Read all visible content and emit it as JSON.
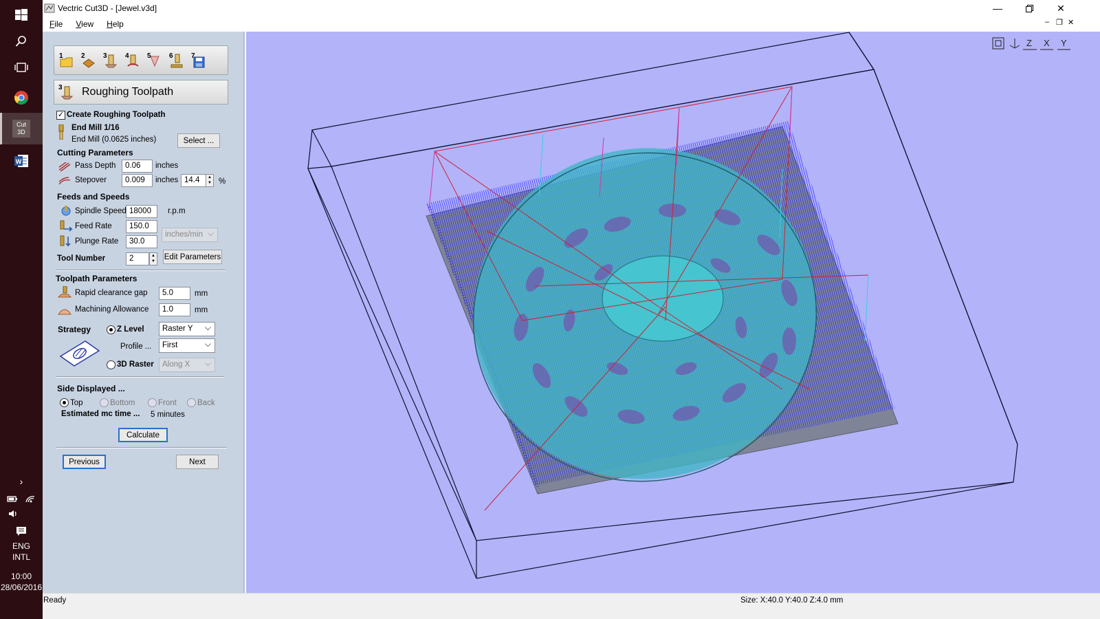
{
  "window": {
    "title": "Vectric Cut3D - [Jewel.v3d]"
  },
  "menu": [
    {
      "key": "F",
      "rest": "ile"
    },
    {
      "key": "V",
      "rest": "iew"
    },
    {
      "key": "H",
      "rest": "elp"
    }
  ],
  "taskbar": {
    "app_label_line1": "Cut",
    "app_label_line2": "3D",
    "language": "ENG",
    "layout": "INTL",
    "time": "10:00",
    "date": "28/06/2016"
  },
  "wizard_steps": [
    "1",
    "2",
    "3",
    "4",
    "5",
    "6",
    "7"
  ],
  "panel": {
    "step_number": "3",
    "heading": "Roughing Toolpath",
    "create_checkbox": {
      "label": "Create Roughing Toolpath",
      "checked": true
    },
    "tool": {
      "name": "End Mill 1/16",
      "description": "End Mill (0.0625 inches)",
      "select_label": "Select ..."
    },
    "cutting": {
      "title": "Cutting Parameters",
      "pass_depth_label": "Pass Depth",
      "pass_depth": "0.06",
      "pass_depth_unit": "inches",
      "stepover_label": "Stepover",
      "stepover": "0.009",
      "stepover_unit": "inches",
      "stepover_pct": "14.4",
      "pct": "%"
    },
    "feeds": {
      "title": "Feeds and Speeds",
      "spindle_label": "Spindle Speed",
      "spindle": "18000",
      "spindle_unit": "r.p.m",
      "feed_label": "Feed Rate",
      "feed": "150.0",
      "plunge_label": "Plunge Rate",
      "plunge": "30.0",
      "rate_unit": "inches/min",
      "tool_number_label": "Tool Number",
      "tool_number": "2",
      "edit_label": "Edit Parameters"
    },
    "toolpath": {
      "title": "Toolpath Parameters",
      "rapid_label": "Rapid clearance gap",
      "rapid": "5.0",
      "rapid_unit": "mm",
      "allowance_label": "Machining Allowance",
      "allowance": "1.0",
      "allowance_unit": "mm"
    },
    "strategy": {
      "title": "Strategy",
      "zlevel_label": "Z Level",
      "zlevel_selected": true,
      "zlevel_option": "Raster Y",
      "profile_label": "Profile ...",
      "profile_option": "First",
      "raster_label": "3D Raster",
      "raster_option": "Along X"
    },
    "side": {
      "title": "Side Displayed ...",
      "options": [
        "Top",
        "Bottom",
        "Front",
        "Back"
      ],
      "selected": "Top",
      "estimate_label": "Estimated mc time ...",
      "estimate_value": "5 minutes"
    },
    "calculate_label": "Calculate",
    "previous_label": "Previous",
    "next_label": "Next"
  },
  "view_toolbar": [
    "zoom-extents-icon",
    "iso-view-icon",
    "view-z-icon",
    "view-x-icon",
    "view-y-icon"
  ],
  "view_axis_labels": [
    "Z",
    "X",
    "Y"
  ],
  "status": {
    "left": "Ready",
    "size": "Size: X:40.0 Y:40.0 Z:4.0 mm"
  },
  "colors": {
    "viewport_bg": "#b3b3fa",
    "toolpath_blue": "#1a1aff",
    "model_cyan": "#3fb6c7",
    "rapid_red": "#cc2233",
    "taskbar_bg": "#2b0d12",
    "panel_bg": "#c8d3e2"
  }
}
